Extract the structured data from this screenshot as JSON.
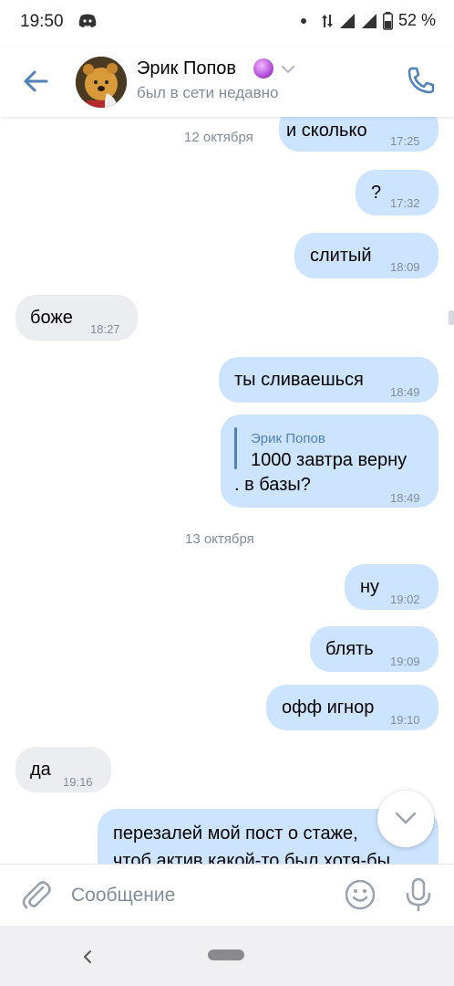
{
  "status_bar": {
    "time": "19:50",
    "battery": "52 %"
  },
  "header": {
    "name": "Эрик Попов",
    "status": "был в сети недавно",
    "icons": {
      "back": "back-arrow-icon",
      "call": "phone-icon",
      "badge": "crystal-ball-icon",
      "chevron": "chevron-down-icon"
    }
  },
  "chat": {
    "dates": [
      "12 октября",
      "13 октября"
    ],
    "messages": [
      {
        "dir": "out",
        "text": "и сколько",
        "time": "17:25"
      },
      {
        "dir": "out",
        "text": "?",
        "time": "17:32"
      },
      {
        "dir": "out",
        "text": "слитый",
        "time": "18:09"
      },
      {
        "dir": "in",
        "text": "боже",
        "time": "18:27"
      },
      {
        "dir": "out",
        "text": "ты сливаешься",
        "time": "18:49"
      },
      {
        "dir": "out",
        "reply_author": "Эрик Попов",
        "reply_text": "1000 завтра верну",
        "text": ". в базы?",
        "time": "18:49"
      },
      {
        "dir": "out",
        "text": "ну",
        "time": "19:02"
      },
      {
        "dir": "out",
        "text": "блять",
        "time": "19:09"
      },
      {
        "dir": "out",
        "text": "офф игнор",
        "time": "19:10"
      },
      {
        "dir": "in",
        "text": "да",
        "time": "19:16"
      },
      {
        "dir": "out",
        "text_line1": "перезалей мой пост о стаже,",
        "text_line2": "чтоб актив какой-то был хотя-бы"
      }
    ]
  },
  "composer": {
    "placeholder": "Сообщение"
  },
  "accent_color": "#5181b8",
  "bubble_out_color": "#cce4ff",
  "bubble_in_color": "#ebedf0"
}
